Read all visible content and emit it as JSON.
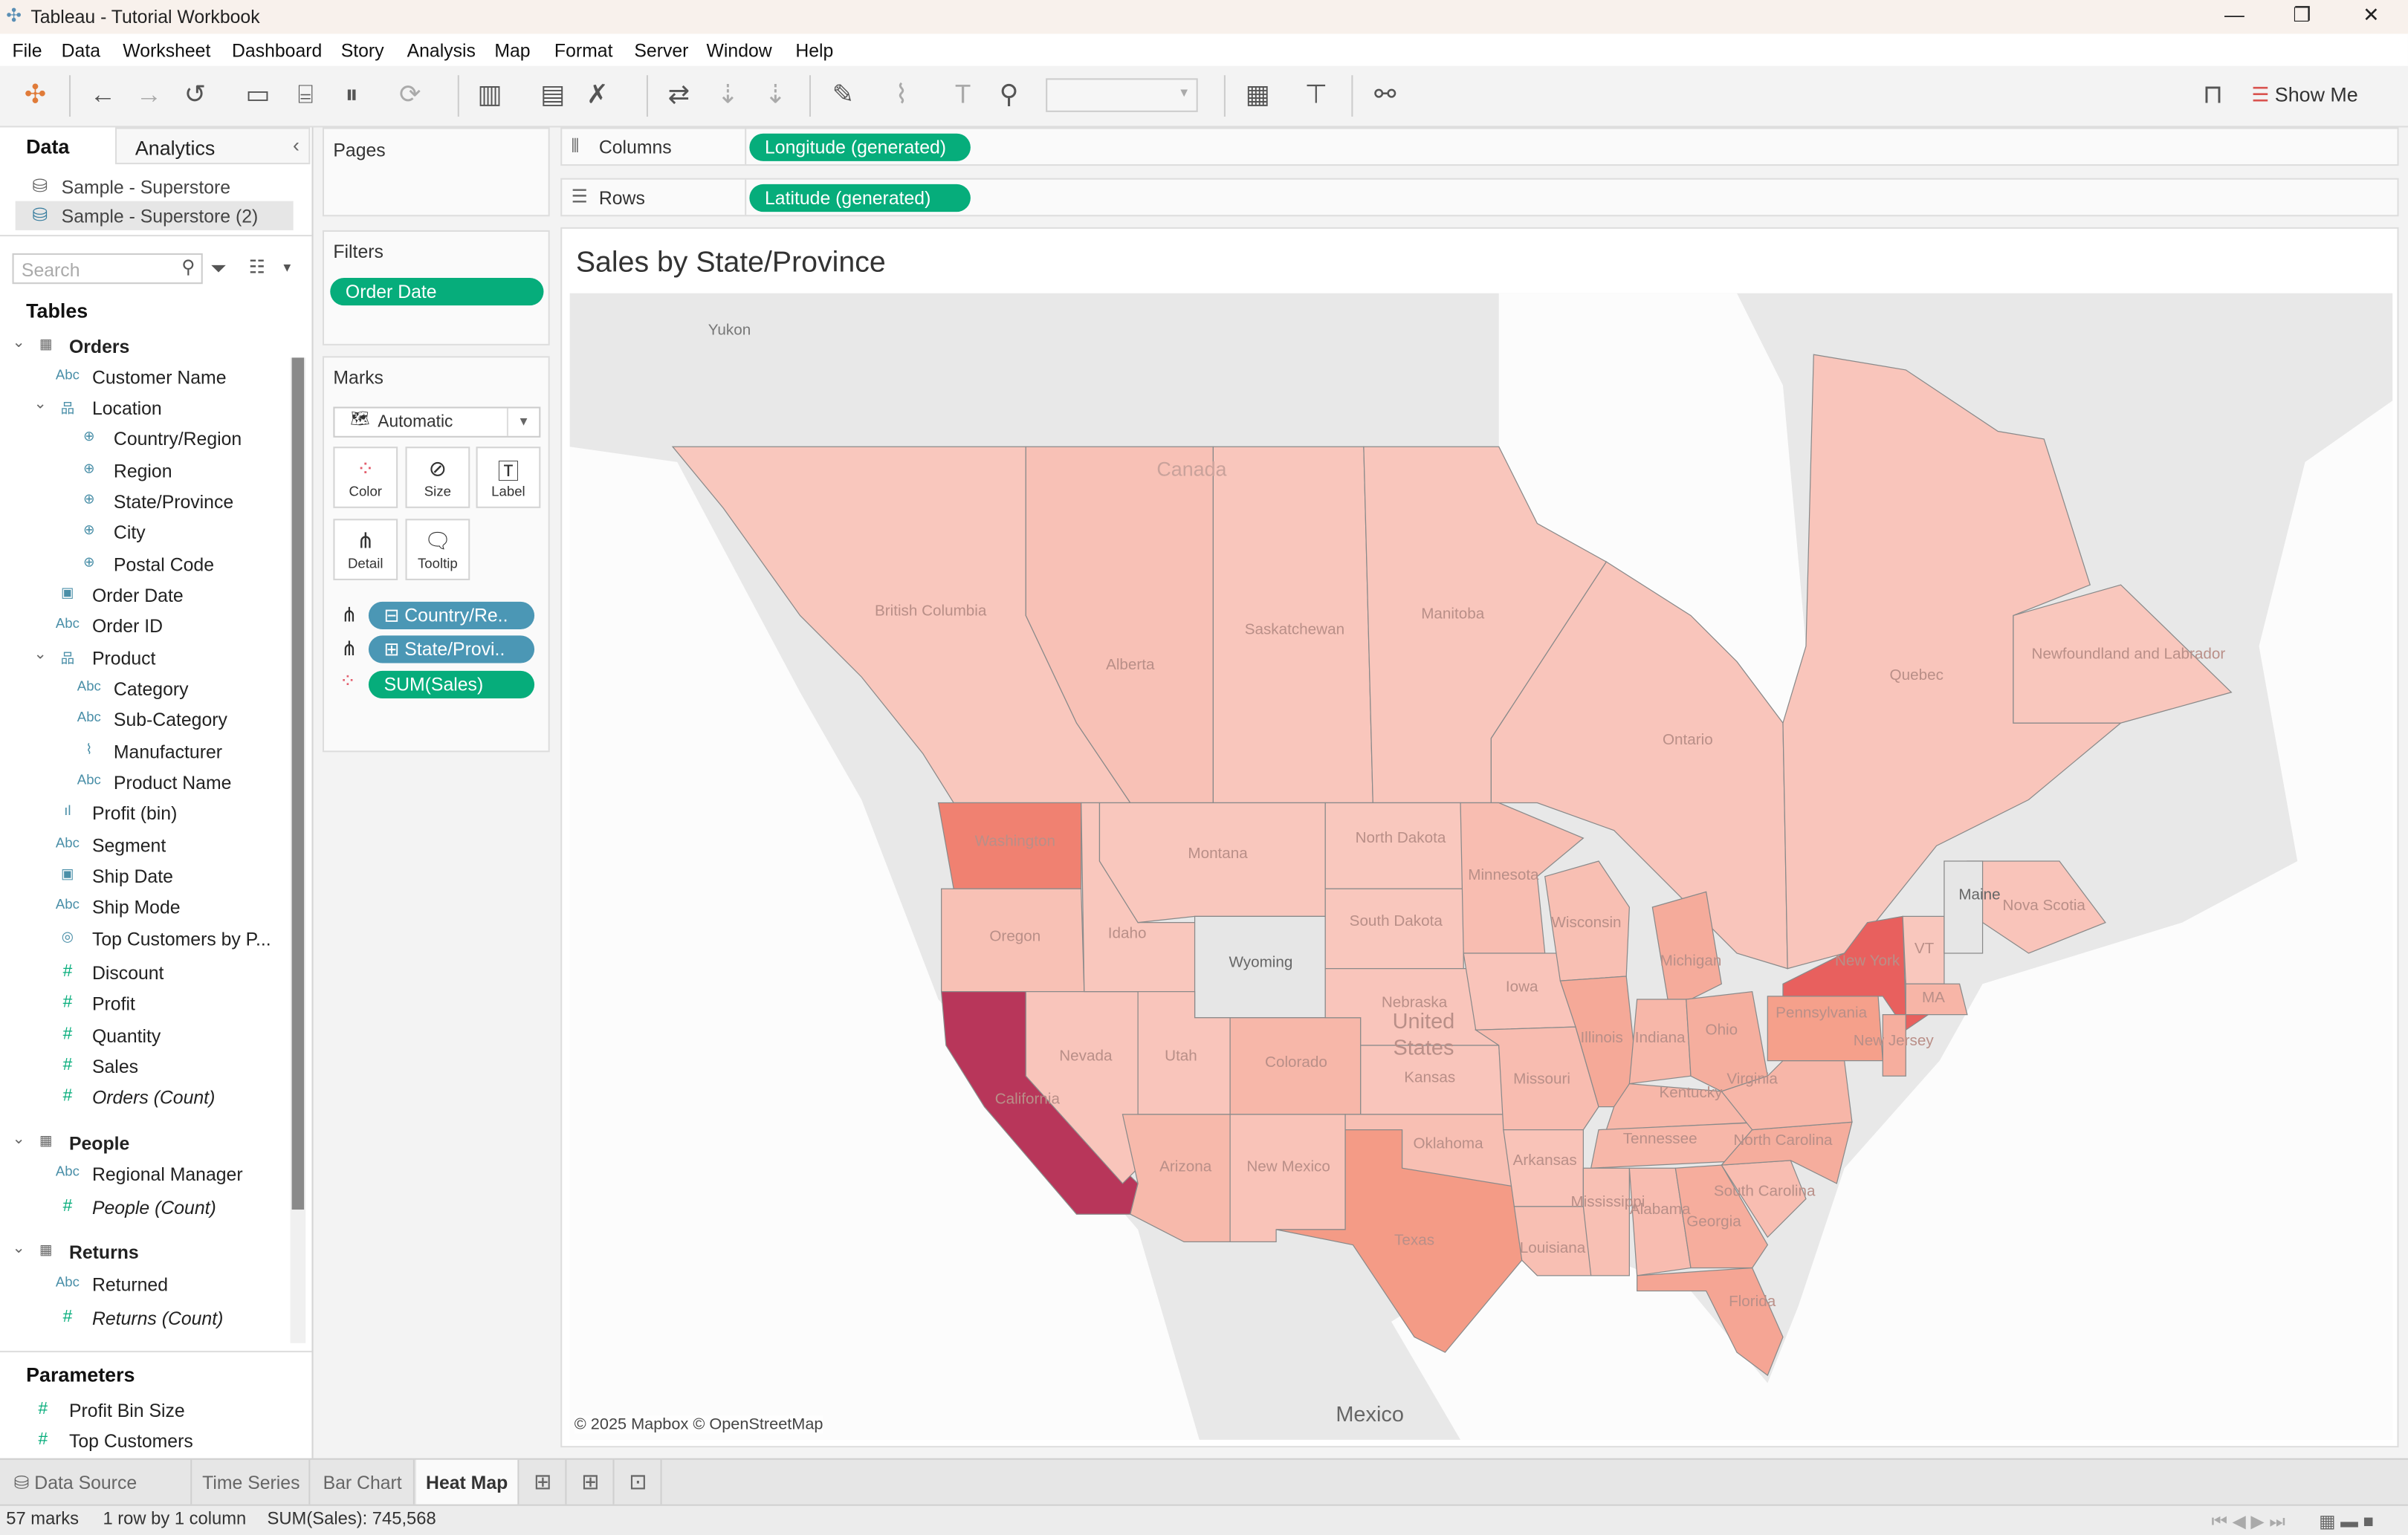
{
  "window": {
    "title": "Tableau - Tutorial Workbook",
    "controls": [
      "—",
      "❐",
      "✕"
    ]
  },
  "menu": [
    "File",
    "Data",
    "Worksheet",
    "Dashboard",
    "Story",
    "Analysis",
    "Map",
    "Format",
    "Server",
    "Window",
    "Help"
  ],
  "toolbar": {
    "show_me": "Show Me",
    "icons": [
      "tableau-logo-icon",
      "back-icon",
      "forward-icon",
      "redirect-icon",
      "save-icon",
      "new-datasource-icon",
      "pause-updates-icon",
      "refresh-icon",
      "new-worksheet-icon",
      "duplicate-sheet-icon",
      "clear-sheet-icon",
      "swap-icon",
      "sort-ascending-icon",
      "sort-descending-icon",
      "highlight-icon",
      "group-icon",
      "show-labels-icon",
      "pin-icon",
      "fit-dropdown",
      "fit-width-icon",
      "presentation-icon",
      "share-icon",
      "presenter-icon"
    ]
  },
  "data_pane": {
    "tab_data": "Data",
    "tab_analytics": "Analytics",
    "datasources": [
      "Sample - Superstore",
      "Sample - Superstore (2)"
    ],
    "search_placeholder": "Search",
    "tables_heading": "Tables",
    "fields": [
      {
        "label": "Orders",
        "type": "table",
        "level": 0,
        "bold": true
      },
      {
        "label": "Customer Name",
        "type": "Abc",
        "level": 1
      },
      {
        "label": "Location",
        "type": "hierarchy",
        "level": 1
      },
      {
        "label": "Country/Region",
        "type": "geo",
        "level": 2
      },
      {
        "label": "Region",
        "type": "geo",
        "level": 2
      },
      {
        "label": "State/Province",
        "type": "geo",
        "level": 2
      },
      {
        "label": "City",
        "type": "geo",
        "level": 2
      },
      {
        "label": "Postal Code",
        "type": "geo",
        "level": 2
      },
      {
        "label": "Order Date",
        "type": "date",
        "level": 1
      },
      {
        "label": "Order ID",
        "type": "Abc",
        "level": 1
      },
      {
        "label": "Product",
        "type": "hierarchy",
        "level": 1
      },
      {
        "label": "Category",
        "type": "Abc",
        "level": 2
      },
      {
        "label": "Sub-Category",
        "type": "Abc",
        "level": 2
      },
      {
        "label": "Manufacturer",
        "type": "clip",
        "level": 2
      },
      {
        "label": "Product Name",
        "type": "Abc",
        "level": 2
      },
      {
        "label": "Profit (bin)",
        "type": "bin",
        "level": 1
      },
      {
        "label": "Segment",
        "type": "Abc",
        "level": 1
      },
      {
        "label": "Ship Date",
        "type": "date",
        "level": 1
      },
      {
        "label": "Ship Mode",
        "type": "Abc",
        "level": 1
      },
      {
        "label": "Top Customers by P...",
        "type": "set",
        "level": 1
      },
      {
        "label": "Discount",
        "type": "measure",
        "level": 1
      },
      {
        "label": "Profit",
        "type": "measure",
        "level": 1
      },
      {
        "label": "Quantity",
        "type": "measure",
        "level": 1
      },
      {
        "label": "Sales",
        "type": "measure",
        "level": 1
      },
      {
        "label": "Orders (Count)",
        "type": "measure",
        "level": 1,
        "italic": true
      },
      {
        "label": "People",
        "type": "table",
        "level": 0,
        "bold": true
      },
      {
        "label": "Regional Manager",
        "type": "Abc",
        "level": 1
      },
      {
        "label": "People (Count)",
        "type": "measure",
        "level": 1,
        "italic": true
      },
      {
        "label": "Returns",
        "type": "table",
        "level": 0,
        "bold": true
      },
      {
        "label": "Returned",
        "type": "Abc",
        "level": 1
      },
      {
        "label": "Returns (Count)",
        "type": "measure",
        "level": 1,
        "italic": true
      }
    ],
    "parameters_heading": "Parameters",
    "parameters": [
      "Profit Bin Size",
      "Top Customers"
    ]
  },
  "pages": {
    "title": "Pages"
  },
  "filters": {
    "title": "Filters",
    "pills": [
      "Order Date"
    ]
  },
  "marks": {
    "title": "Marks",
    "type": "Automatic",
    "buttons": [
      "Color",
      "Size",
      "Label",
      "Detail",
      "Tooltip"
    ],
    "pills": [
      {
        "label": "Country/Re..",
        "prefix": "⊟",
        "kind": "detail"
      },
      {
        "label": "State/Provi..",
        "prefix": "⊞",
        "kind": "detail"
      },
      {
        "label": "SUM(Sales)",
        "prefix": "",
        "kind": "color"
      }
    ]
  },
  "shelves": {
    "columns_label": "Columns",
    "columns_pill": "Longitude (generated)",
    "rows_label": "Rows",
    "rows_pill": "Latitude (generated)"
  },
  "colors": {
    "dimension_pill": "#4b97b5",
    "measure_pill": "#06ad7b",
    "sales_high": "#b8365a",
    "sales_low": "#f9c8bf",
    "no_data": "#e6e6e6"
  },
  "view": {
    "title": "Sales by State/Province",
    "attribution": "© 2025 Mapbox © OpenStreetMap",
    "base_labels": [
      "Yukon",
      "Canada",
      "United",
      "States",
      "Mexico"
    ],
    "regions": [
      {
        "name": "British Columbia",
        "fill": "#f9c7bd"
      },
      {
        "name": "Alberta",
        "fill": "#f8c1b6"
      },
      {
        "name": "Saskatchewan",
        "fill": "#f9c6bc"
      },
      {
        "name": "Manitoba",
        "fill": "#f9c6bc"
      },
      {
        "name": "Ontario",
        "fill": "#f9c5bb"
      },
      {
        "name": "Quebec",
        "fill": "#f9c5bb"
      },
      {
        "name": "Newfoundland and Labrador",
        "fill": "#f9c7bd"
      },
      {
        "name": "Nova Scotia",
        "fill": "#f9c4ba"
      },
      {
        "name": "Washington",
        "fill": "#f08171"
      },
      {
        "name": "Oregon",
        "fill": "#f8c1b5"
      },
      {
        "name": "California",
        "fill": "#b8365a"
      },
      {
        "name": "Nevada",
        "fill": "#f9c5bb"
      },
      {
        "name": "Idaho",
        "fill": "#f9c7bd"
      },
      {
        "name": "Montana",
        "fill": "#f9c7bd"
      },
      {
        "name": "Wyoming",
        "fill": "#e6e6e6"
      },
      {
        "name": "Utah",
        "fill": "#f9c5bb"
      },
      {
        "name": "Colorado",
        "fill": "#f7b7a9"
      },
      {
        "name": "Arizona",
        "fill": "#f7b9ab"
      },
      {
        "name": "New Mexico",
        "fill": "#f9c3b8"
      },
      {
        "name": "North Dakota",
        "fill": "#f9c8be"
      },
      {
        "name": "South Dakota",
        "fill": "#f9c7bd"
      },
      {
        "name": "Nebraska",
        "fill": "#f9c5bb"
      },
      {
        "name": "Kansas",
        "fill": "#f9c5bb"
      },
      {
        "name": "Oklahoma",
        "fill": "#f8bfb3"
      },
      {
        "name": "Texas",
        "fill": "#f49b86"
      },
      {
        "name": "Minnesota",
        "fill": "#f8bdb1"
      },
      {
        "name": "Iowa",
        "fill": "#f9c4ba"
      },
      {
        "name": "Missouri",
        "fill": "#f8bcb0"
      },
      {
        "name": "Arkansas",
        "fill": "#f9c3b8"
      },
      {
        "name": "Louisiana",
        "fill": "#f8bfb3"
      },
      {
        "name": "Wisconsin",
        "fill": "#f8bfb3"
      },
      {
        "name": "Illinois",
        "fill": "#f5a998"
      },
      {
        "name": "Michigan",
        "fill": "#f5ab9b"
      },
      {
        "name": "Indiana",
        "fill": "#f7b7a9"
      },
      {
        "name": "Ohio",
        "fill": "#f5ae9e"
      },
      {
        "name": "Kentucky",
        "fill": "#f7b7a9"
      },
      {
        "name": "Tennessee",
        "fill": "#f7b7a9"
      },
      {
        "name": "Mississippi",
        "fill": "#f8c0b4"
      },
      {
        "name": "Alabama",
        "fill": "#f8bcb0"
      },
      {
        "name": "Georgia",
        "fill": "#f6ad9d"
      },
      {
        "name": "Florida",
        "fill": "#f5a594"
      },
      {
        "name": "South Carolina",
        "fill": "#f8bdb1"
      },
      {
        "name": "North Carolina",
        "fill": "#f5ad9d"
      },
      {
        "name": "Virginia",
        "fill": "#f7b6a8"
      },
      {
        "name": "Pennsylvania",
        "fill": "#f5a08b"
      },
      {
        "name": "New York",
        "fill": "#e8605e"
      },
      {
        "name": "VT",
        "fill": "#f9c7bd"
      },
      {
        "name": "MA",
        "fill": "#f7b5a7"
      },
      {
        "name": "New Jersey",
        "fill": "#f6ae9e"
      },
      {
        "name": "Maine",
        "fill": "#e6e6e6"
      }
    ]
  },
  "sheet_tabs": {
    "data_source": "Data Source",
    "tabs": [
      "Time Series",
      "Bar Chart",
      "Heat Map"
    ],
    "active": "Heat Map"
  },
  "status": {
    "marks": "57 marks",
    "dims": "1 row by 1 column",
    "sum": "SUM(Sales): 745,568"
  }
}
